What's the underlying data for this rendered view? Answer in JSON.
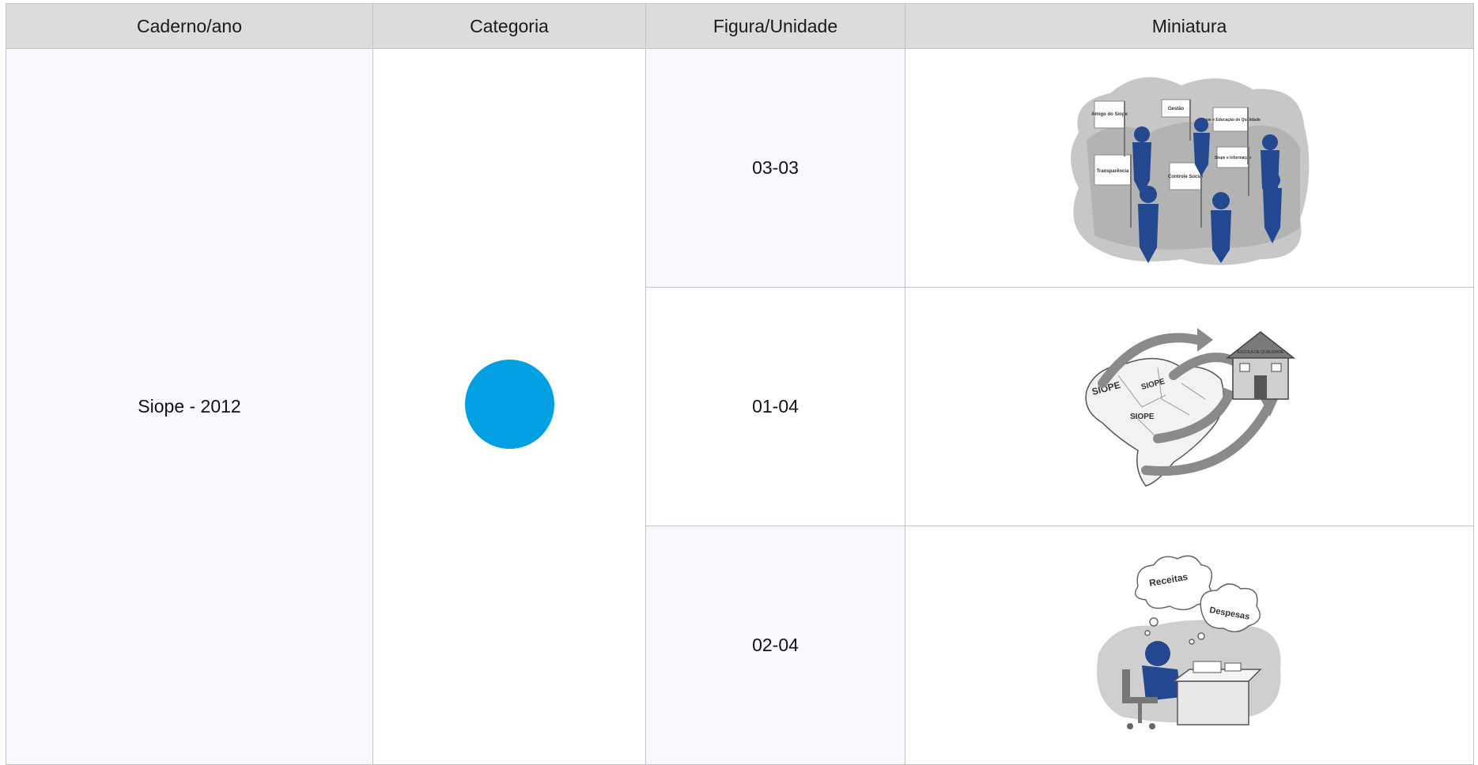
{
  "table": {
    "headers": {
      "caderno": "Caderno/ano",
      "categoria": "Categoria",
      "figura": "Figura/Unidade",
      "miniatura": "Miniatura"
    },
    "caderno_value": "Siope - 2012",
    "categoria_color": "#00a0e3",
    "rows": [
      {
        "figura": "03-03",
        "thumbnail": "people-with-flags-illustration",
        "signs": [
          "Amigo do Siope",
          "Gestão",
          "Siope e Educação de Qualidade",
          "Transparência",
          "Controle Social",
          "Siope e Informação"
        ]
      },
      {
        "figura": "01-04",
        "thumbnail": "brazil-map-arrows-to-school-illustration",
        "signs": [
          "SIOPE",
          "SIOPE",
          "SIOPE",
          "ESCOLA DE QUALIDADE"
        ]
      },
      {
        "figura": "02-04",
        "thumbnail": "person-at-desk-thinking-illustration",
        "signs": [
          "Receitas",
          "Despesas"
        ]
      }
    ]
  }
}
